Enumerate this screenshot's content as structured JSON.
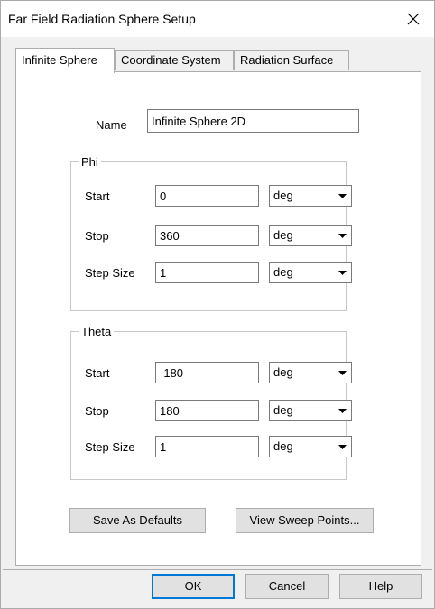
{
  "window": {
    "title": "Far Field Radiation Sphere Setup"
  },
  "tabs": [
    {
      "label": "Infinite Sphere",
      "active": true
    },
    {
      "label": "Coordinate System",
      "active": false
    },
    {
      "label": "Radiation Surface",
      "active": false
    }
  ],
  "name": {
    "label": "Name",
    "value": "Infinite Sphere 2D"
  },
  "phi": {
    "legend": "Phi",
    "start": {
      "label": "Start",
      "value": "0",
      "unit": "deg"
    },
    "stop": {
      "label": "Stop",
      "value": "360",
      "unit": "deg"
    },
    "step": {
      "label": "Step Size",
      "value": "1",
      "unit": "deg"
    }
  },
  "theta": {
    "legend": "Theta",
    "start": {
      "label": "Start",
      "value": "-180",
      "unit": "deg"
    },
    "stop": {
      "label": "Stop",
      "value": "180",
      "unit": "deg"
    },
    "step": {
      "label": "Step Size",
      "value": "1",
      "unit": "deg"
    }
  },
  "buttons": {
    "save_defaults": "Save As Defaults",
    "view_sweep": "View Sweep Points...",
    "ok": "OK",
    "cancel": "Cancel",
    "help": "Help"
  },
  "icons": {
    "close": "close-icon",
    "dropdown": "chevron-down-icon"
  }
}
